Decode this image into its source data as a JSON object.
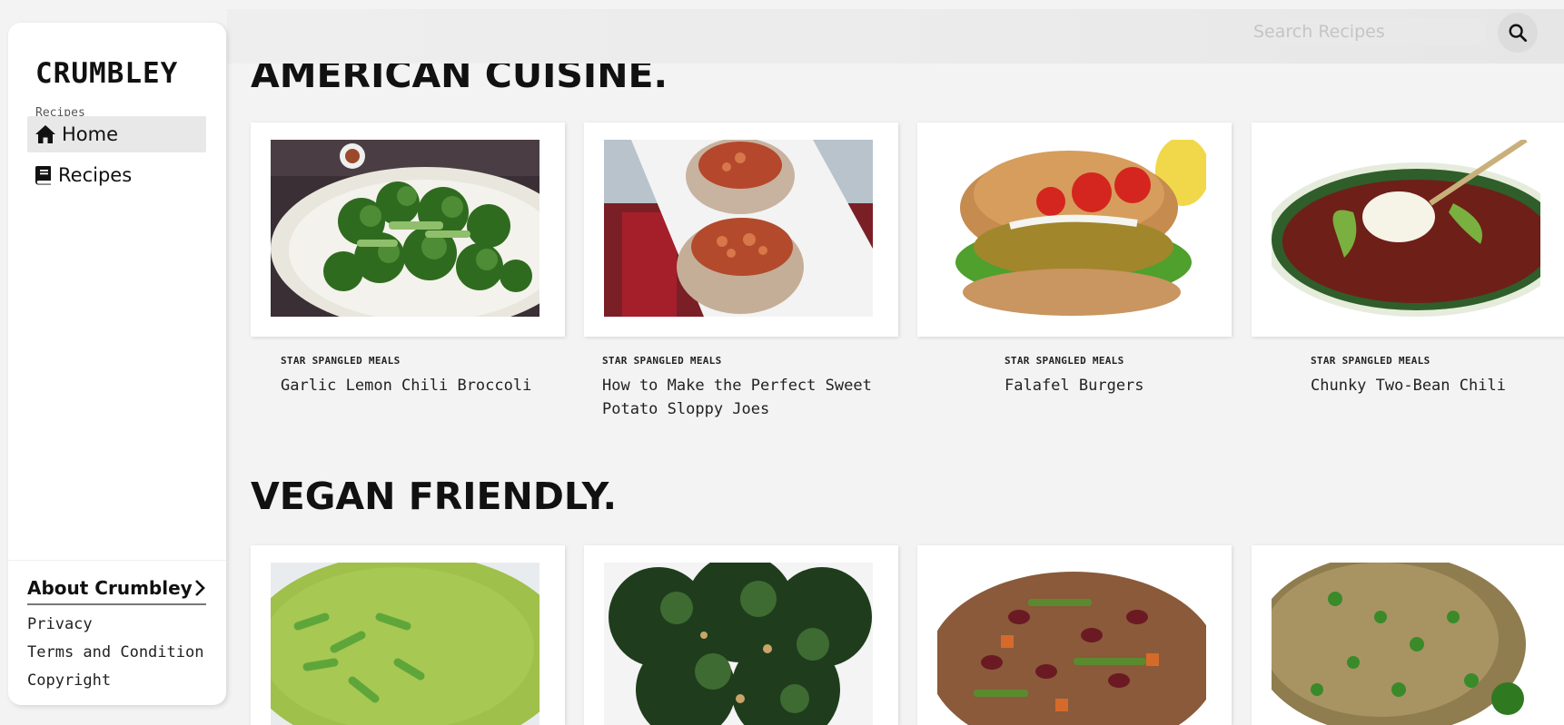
{
  "brand": {
    "logo": "CRUMBLEY",
    "subtitle": "Recipes"
  },
  "search": {
    "placeholder": "Search Recipes",
    "icon": "search-icon"
  },
  "nav": [
    {
      "label": "Home",
      "icon": "home-icon",
      "active": true
    },
    {
      "label": "Recipes",
      "icon": "book-icon",
      "active": false
    }
  ],
  "footer": {
    "about": "About Crumbley",
    "links": [
      "Privacy",
      "Terms and Condition",
      "Copyright"
    ]
  },
  "sections": [
    {
      "title": "AMERICAN CUISINE.",
      "cards": [
        {
          "category": "STAR SPANGLED MEALS",
          "name": "Garlic Lemon Chili Broccoli"
        },
        {
          "category": "STAR SPANGLED MEALS",
          "name": "How to Make the Perfect Sweet Potato Sloppy Joes"
        },
        {
          "category": "STAR SPANGLED MEALS",
          "name": "Falafel Burgers"
        },
        {
          "category": "STAR SPANGLED MEALS",
          "name": "Chunky Two-Bean Chili"
        }
      ]
    },
    {
      "title": "VEGAN FRIENDLY."
    }
  ],
  "colors": {
    "accent": "#111111",
    "background": "#f3f3f3",
    "card": "#ffffff"
  }
}
